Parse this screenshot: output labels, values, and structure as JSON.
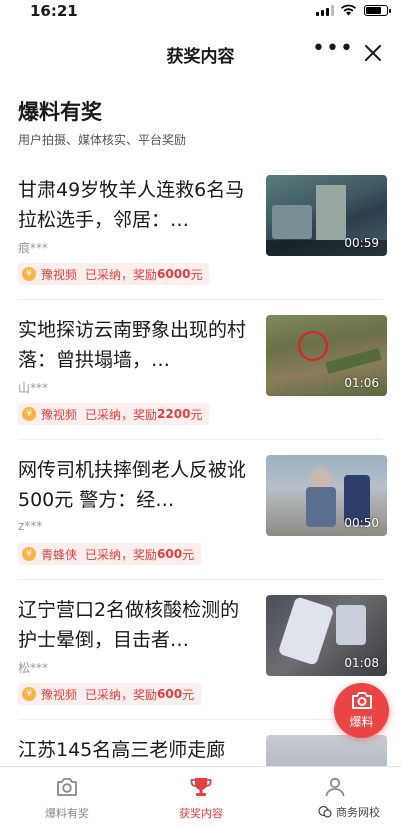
{
  "status_bar": {
    "time": "16:21"
  },
  "navbar": {
    "title": "获奖内容",
    "more_label": "•••"
  },
  "header": {
    "title": "爆料有奖",
    "subtitle": "用户拍摄、媒体核实、平台奖励"
  },
  "feed": [
    {
      "title": "甘肃49岁牧羊人连救6名马拉松选手，邻居：…",
      "author": "痕***",
      "source": "豫视频",
      "status": "已采纳，奖励",
      "amount": "6000",
      "unit": "元",
      "duration": "00:59"
    },
    {
      "title": "实地探访云南野象出现的村落：曾拱塌墙，…",
      "author": "山***",
      "source": "豫视频",
      "status": "已采纳，奖励",
      "amount": "2200",
      "unit": "元",
      "duration": "01:06"
    },
    {
      "title": "网传司机扶摔倒老人反被讹500元 警方：经…",
      "author": "z***",
      "source": "青蜂侠",
      "status": "已采纳，奖励",
      "amount": "600",
      "unit": "元",
      "duration": "00:50"
    },
    {
      "title": "辽宁营口2名做核酸检测的护士晕倒，目击者…",
      "author": "松***",
      "source": "豫视频",
      "status": "已采纳，奖励",
      "amount": "600",
      "unit": "元",
      "duration": "01:08"
    },
    {
      "title": "江苏145名高三老师走廊",
      "author": "",
      "source": "",
      "status": "",
      "amount": "",
      "unit": "",
      "duration": ""
    }
  ],
  "fab": {
    "label": "爆料"
  },
  "tabbar": {
    "tabs": [
      {
        "label": "爆料有奖",
        "icon": "camera-icon"
      },
      {
        "label": "获奖内容",
        "icon": "trophy-icon"
      },
      {
        "label": "",
        "icon": "user-icon"
      }
    ]
  },
  "watermark": {
    "text": "商务网校"
  },
  "colors": {
    "accent": "#e0403f",
    "fab": "#ea4544",
    "reward_bg": "#fdeeee",
    "coin": "#f6b445"
  }
}
